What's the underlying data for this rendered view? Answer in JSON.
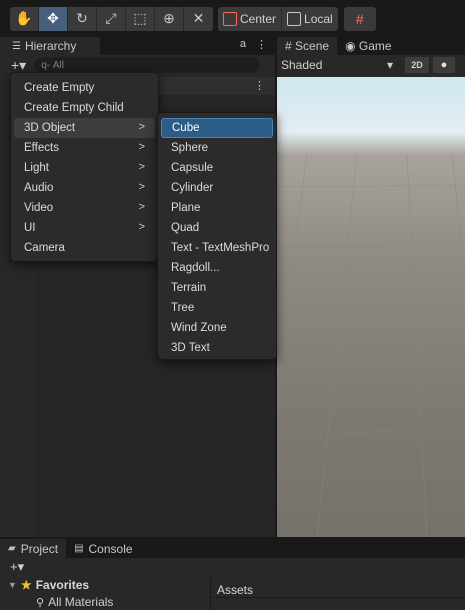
{
  "toolbar": {
    "tools": [
      {
        "icon": "hand-icon",
        "glyph": "✋"
      },
      {
        "icon": "move-icon",
        "glyph": "✥"
      },
      {
        "icon": "rotate-icon",
        "glyph": "↻"
      },
      {
        "icon": "scale-icon",
        "glyph": "⤢"
      },
      {
        "icon": "rect-icon",
        "glyph": "⬚"
      },
      {
        "icon": "transform-icon",
        "glyph": "⊕"
      },
      {
        "icon": "custom-tool-icon",
        "glyph": "✕"
      }
    ],
    "pivot_label": "Center",
    "space_label": "Local",
    "grid_glyph": "#"
  },
  "hierarchy": {
    "tab_label": "Hierarchy",
    "tab_icon": "☰",
    "lock_glyph": "🔒",
    "more_glyph": "⋮",
    "plus_label": "+▾",
    "search_placeholder": "All",
    "search_glyph": "⚲"
  },
  "scene": {
    "tabs": [
      {
        "label": "Scene",
        "glyph": "#"
      },
      {
        "label": "Game",
        "glyph": "◉"
      }
    ],
    "shading_mode": "Shaded",
    "shading_arrow": "▾",
    "mode_2d": "2D",
    "light_glyph": "💡"
  },
  "context_menu": {
    "items": [
      {
        "label": "Create Empty",
        "has_submenu": false
      },
      {
        "label": "Create Empty Child",
        "has_submenu": false
      },
      {
        "label": "3D Object",
        "has_submenu": true
      },
      {
        "label": "Effects",
        "has_submenu": true
      },
      {
        "label": "Light",
        "has_submenu": true
      },
      {
        "label": "Audio",
        "has_submenu": true
      },
      {
        "label": "Video",
        "has_submenu": true
      },
      {
        "label": "UI",
        "has_submenu": true
      },
      {
        "label": "Camera",
        "has_submenu": false
      }
    ],
    "arrow_glyph": ">"
  },
  "submenu_3d": {
    "items": [
      "Cube",
      "Sphere",
      "Capsule",
      "Cylinder",
      "Plane",
      "Quad",
      "Text - TextMeshPro",
      "Ragdoll...",
      "Terrain",
      "Tree",
      "Wind Zone",
      "3D Text"
    ]
  },
  "bottom": {
    "tabs": [
      {
        "label": "Project",
        "glyph": "▰"
      },
      {
        "label": "Console",
        "glyph": "▤"
      }
    ],
    "plus_label": "+▾",
    "favorites_label": "Favorites",
    "favorites_item": "All Materials",
    "assets_label": "Assets"
  }
}
